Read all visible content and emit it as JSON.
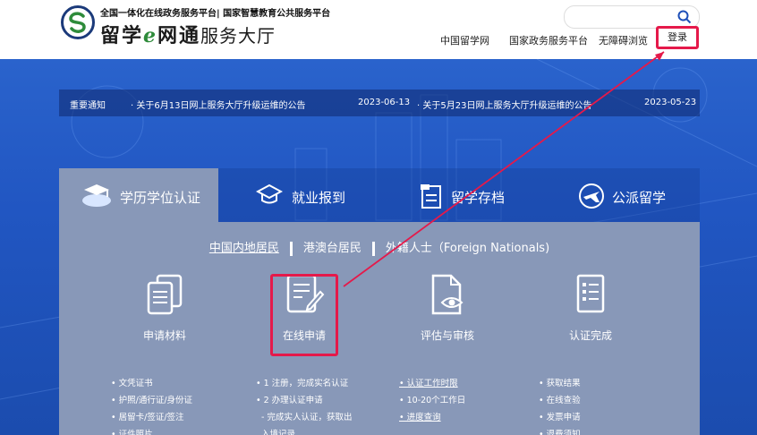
{
  "header": {
    "tagline": "全国一体化在线政务服务平台| 国家智慧教育公共服务平台",
    "logo_title": "留学",
    "logo_e": "e",
    "logo_title2": "网通",
    "logo_service": "服务大厅",
    "search_placeholder": "",
    "nav": [
      "中国留学网",
      "国家政务服务平台",
      "无障碍浏览"
    ],
    "login": "登录"
  },
  "notice": {
    "label": "重要通知",
    "items": [
      {
        "text": "· 关于6月13日网上服务大厅升级运维的公告",
        "date": "2023-06-13"
      },
      {
        "text": "· 关于5月23日网上服务大厅升级运维的公告",
        "date": "2023-05-23"
      }
    ]
  },
  "tabs": [
    {
      "label": "学历学位认证",
      "icon": "graduation-cap-cloud-icon"
    },
    {
      "label": "就业报到",
      "icon": "mortarboard-icon"
    },
    {
      "label": "留学存档",
      "icon": "archive-document-icon"
    },
    {
      "label": "公派留学",
      "icon": "airplane-icon"
    }
  ],
  "subtabs": [
    "中国内地居民",
    "港澳台居民",
    "外籍人士（Foreign Nationals)"
  ],
  "steps": [
    {
      "label": "申请材料",
      "icon": "documents-icon"
    },
    {
      "label": "在线申请",
      "icon": "edit-form-icon"
    },
    {
      "label": "评估与审核",
      "icon": "file-eye-icon"
    },
    {
      "label": "认证完成",
      "icon": "checklist-icon"
    }
  ],
  "columns": [
    [
      "• 文凭证书",
      "• 护照/通行证/身份证",
      "• 居留卡/签证/签注",
      "• 证件照片"
    ],
    [
      "• 1 注册，完成实名认证",
      "• 2 办理认证申请",
      "  - 完成实人认证，获取出",
      "  入境记录"
    ],
    [
      "• 认证工作时限",
      "• 10-20个工作日",
      "• 进度查询"
    ],
    [
      "• 获取结果",
      "• 在线查验",
      "• 发票申请",
      "• 退费须知"
    ]
  ],
  "colors": {
    "accent_red": "#e5194a",
    "hero_blue": "#2156c2",
    "panel": "#8898b8"
  }
}
